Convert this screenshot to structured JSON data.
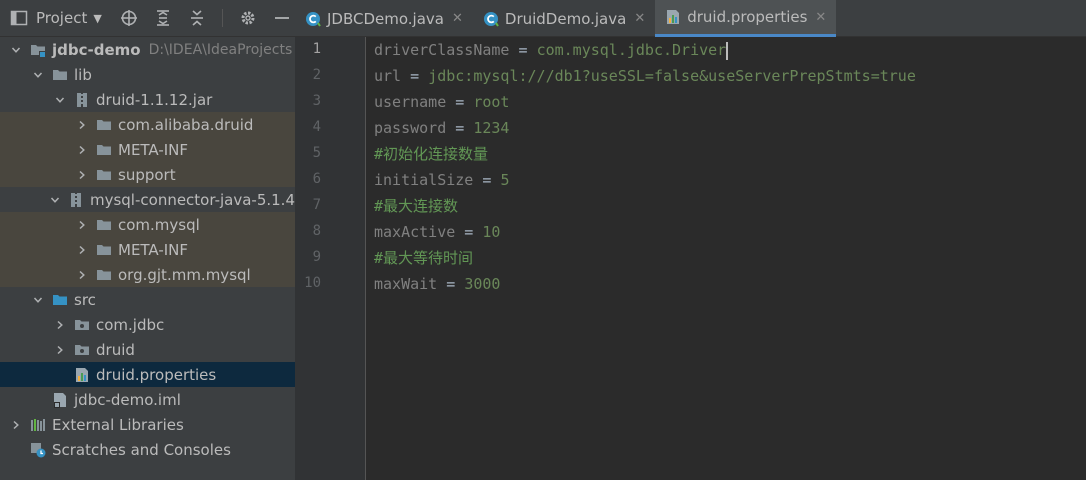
{
  "project_panel": {
    "title": "Project",
    "tree": [
      {
        "label": "jdbc-demo",
        "path": "D:\\IDEA\\IdeaProjects",
        "depth": 0,
        "expanded": true,
        "icon": "module-folder-icon",
        "bold": true
      },
      {
        "label": "lib",
        "depth": 1,
        "expanded": true,
        "icon": "folder-icon"
      },
      {
        "label": "druid-1.1.12.jar",
        "depth": 2,
        "expanded": true,
        "icon": "jar-icon"
      },
      {
        "label": "com.alibaba.druid",
        "depth": 3,
        "expanded": false,
        "icon": "folder-icon"
      },
      {
        "label": "META-INF",
        "depth": 3,
        "expanded": false,
        "icon": "folder-icon"
      },
      {
        "label": "support",
        "depth": 3,
        "expanded": false,
        "icon": "folder-icon"
      },
      {
        "label": "mysql-connector-java-5.1.4",
        "depth": 2,
        "expanded": true,
        "icon": "jar-icon"
      },
      {
        "label": "com.mysql",
        "depth": 3,
        "expanded": false,
        "icon": "folder-icon"
      },
      {
        "label": "META-INF",
        "depth": 3,
        "expanded": false,
        "icon": "folder-icon"
      },
      {
        "label": "org.gjt.mm.mysql",
        "depth": 3,
        "expanded": false,
        "icon": "folder-icon"
      },
      {
        "label": "src",
        "depth": 1,
        "expanded": true,
        "icon": "source-folder-icon"
      },
      {
        "label": "com.jdbc",
        "depth": 2,
        "expanded": false,
        "icon": "package-icon"
      },
      {
        "label": "druid",
        "depth": 2,
        "expanded": false,
        "icon": "package-icon"
      },
      {
        "label": "druid.properties",
        "depth": 2,
        "icon": "properties-file-icon",
        "selected": true
      },
      {
        "label": "jdbc-demo.iml",
        "depth": 1,
        "icon": "iml-file-icon"
      },
      {
        "label": "External Libraries",
        "depth": 0,
        "expanded": false,
        "icon": "libraries-icon"
      },
      {
        "label": "Scratches and Consoles",
        "depth": 0,
        "icon": "scratches-icon"
      }
    ]
  },
  "tabs": [
    {
      "label": "JDBCDemo.java",
      "icon": "java-class-icon",
      "active": false
    },
    {
      "label": "DruidDemo.java",
      "icon": "java-class-icon",
      "active": false
    },
    {
      "label": "druid.properties",
      "icon": "properties-file-icon",
      "active": true
    }
  ],
  "editor": {
    "current_line": 1,
    "lines": [
      {
        "n": "1",
        "key": "driverClassName",
        "value": "com.mysql.jdbc.Driver"
      },
      {
        "n": "2",
        "key": "url",
        "value": "jdbc:mysql:///db1?useSSL=false&useServerPrepStmts=true"
      },
      {
        "n": "3",
        "key": "username",
        "value": "root"
      },
      {
        "n": "4",
        "key": "password",
        "value": "1234"
      },
      {
        "n": "5",
        "comment": "#初始化连接数量"
      },
      {
        "n": "6",
        "key": "initialSize",
        "value": "5"
      },
      {
        "n": "7",
        "comment": "#最大连接数"
      },
      {
        "n": "8",
        "key": "maxActive",
        "value": "10"
      },
      {
        "n": "9",
        "comment": "#最大等待时间"
      },
      {
        "n": "10",
        "key": "maxWait",
        "value": "3000"
      }
    ]
  },
  "colors": {
    "key": "#808080",
    "value": "#6a8759",
    "comment": "#629755",
    "selection": "#0d293e",
    "library_row": "#49463e",
    "active_tab_underline": "#4a88c7"
  }
}
